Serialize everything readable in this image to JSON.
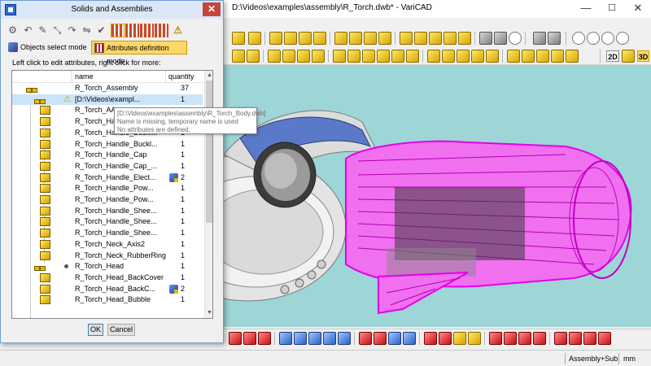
{
  "app": {
    "title": "D:\\Videos\\examples\\assembly\\R_Torch.dwb* - VariCAD",
    "minimize": "—",
    "maximize": "☐",
    "close": "✕"
  },
  "toolbar": {
    "view_2d": "2D",
    "view_3d": "3D"
  },
  "dialog": {
    "title": "Solids and Assemblies",
    "close": "✕",
    "modes": {
      "objects_select": "Objects select mode",
      "attributes_definition": "Attributes definition mode",
      "active": "attributes_definition"
    },
    "hint": "Left click to edit attributes, right click for more:",
    "columns": {
      "name": "name",
      "quantity": "quantity"
    },
    "rows": [
      {
        "name": "R_Torch_Assembly",
        "qty": "37"
      },
      {
        "name": "[D:\\Videos\\exampl...",
        "qty": "1"
      },
      {
        "name": "R_Torch_AA",
        "qty": ""
      },
      {
        "name": "R_Torch_Ha",
        "qty": ""
      },
      {
        "name": "R_Torch_Handle_Buckl...",
        "qty": "1"
      },
      {
        "name": "R_Torch_Handle_Buckl...",
        "qty": "1"
      },
      {
        "name": "R_Torch_Handle_Cap",
        "qty": "1"
      },
      {
        "name": "R_Torch_Handle_Cap_...",
        "qty": "1"
      },
      {
        "name": "R_Torch_Handle_Elect...",
        "qty": "2"
      },
      {
        "name": "R_Torch_Handle_Pow...",
        "qty": "1"
      },
      {
        "name": "R_Torch_Handle_Pow...",
        "qty": "1"
      },
      {
        "name": "R_Torch_Handle_Shee...",
        "qty": "1"
      },
      {
        "name": "R_Torch_Handle_Shee...",
        "qty": "1"
      },
      {
        "name": "R_Torch_Handle_Shee...",
        "qty": "1"
      },
      {
        "name": "R_Torch_Neck_Axis2",
        "qty": "1"
      },
      {
        "name": "R_Torch_Neck_RubberRing",
        "qty": "1"
      },
      {
        "name": "R_Torch_Head",
        "qty": "1"
      },
      {
        "name": "R_Torch_Head_BackCover",
        "qty": "1"
      },
      {
        "name": "R_Torch_Head_BackC...",
        "qty": "2"
      },
      {
        "name": "R_Torch_Head_Bubble",
        "qty": "1"
      }
    ],
    "tooltip": {
      "path": "[D:\\Videos\\examples\\assembly\\R_Torch_Body.dwb]",
      "line1": "Name is missing, temporary name is used",
      "line2": "No attributes are defined."
    },
    "ok": "OK",
    "cancel": "Cancel"
  },
  "status": {
    "mode": "Assembly+Sub.",
    "units": "mm"
  },
  "colors": {
    "viewport_bg": "#9ed5d6",
    "selected_part": "#e600e6",
    "body_gray": "#e2e2e2",
    "accent_blue": "#5b79c9"
  }
}
